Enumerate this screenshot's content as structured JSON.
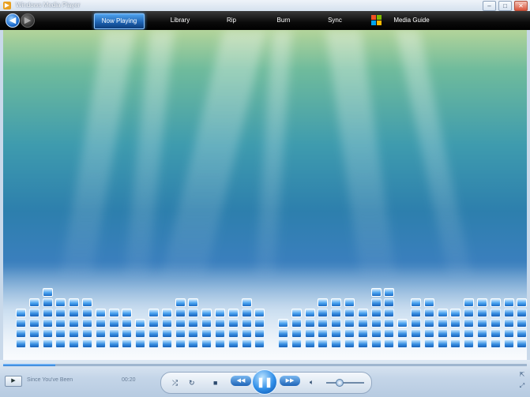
{
  "window": {
    "title": "Windows Media Player"
  },
  "nav": {
    "tabs": [
      {
        "label": "Now Playing",
        "active": true
      },
      {
        "label": "Library",
        "active": false
      },
      {
        "label": "Rip",
        "active": false
      },
      {
        "label": "Burn",
        "active": false
      },
      {
        "label": "Sync",
        "active": false
      },
      {
        "label": "Media Guide",
        "active": false
      }
    ]
  },
  "player": {
    "track_title": "Since You've Been",
    "elapsed_time": "00:20",
    "seek_progress": 0.1,
    "volume_level": 0.33
  },
  "icons": {
    "app": "media-player-icon",
    "back": "back-arrow-icon",
    "forward": "forward-arrow-icon",
    "shuffle": "shuffle-icon",
    "repeat": "repeat-icon",
    "stop": "stop-icon",
    "previous": "previous-icon",
    "pause": "pause-icon",
    "next": "next-icon",
    "volume": "speaker-icon",
    "logo": "windows-logo-icon"
  },
  "visualization": {
    "style": "bars-and-waves",
    "levels": [
      3,
      4,
      5,
      4,
      4,
      4,
      3,
      3,
      3,
      2,
      3,
      3,
      4,
      4,
      3,
      3,
      3,
      4,
      3,
      2,
      3,
      3,
      4,
      4,
      4,
      3,
      5,
      5,
      2,
      4,
      4,
      3,
      3,
      4,
      4,
      4,
      4,
      4
    ]
  },
  "colors": {
    "accent": "#2f8ee8",
    "nav_background": "#000000",
    "chrome": "#c9d9ea"
  }
}
